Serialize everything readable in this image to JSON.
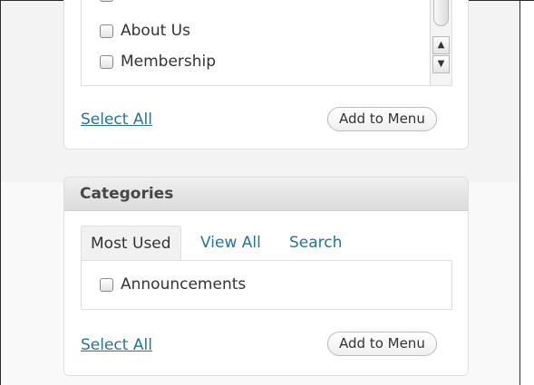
{
  "pages_panel": {
    "items": [
      {
        "label": ""
      },
      {
        "label": "About Us"
      },
      {
        "label": "Membership"
      }
    ],
    "select_all": "Select All",
    "add_button": "Add to Menu",
    "scroll_up_glyph": "▲",
    "scroll_down_glyph": "▼"
  },
  "categories_panel": {
    "title": "Categories",
    "tabs": [
      {
        "label": "Most Used",
        "active": true
      },
      {
        "label": "View All",
        "active": false
      },
      {
        "label": "Search",
        "active": false
      }
    ],
    "items": [
      {
        "label": "Announcements"
      }
    ],
    "select_all": "Select All",
    "add_button": "Add to Menu"
  },
  "colors": {
    "link": "#21759b",
    "panel_header": "#dcdcdc",
    "border": "#dfdfdf"
  }
}
